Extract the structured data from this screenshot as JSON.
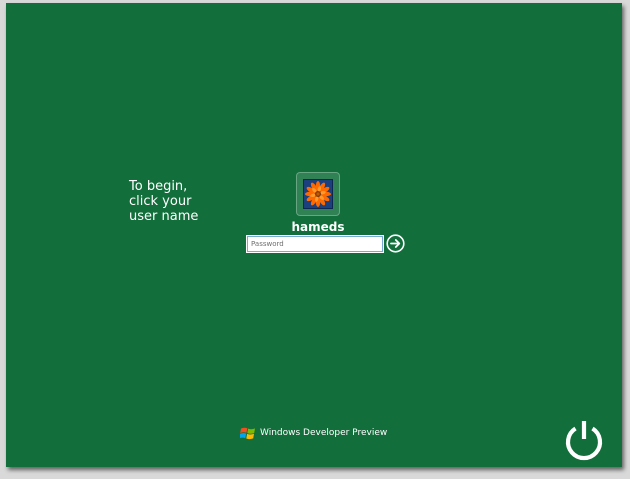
{
  "instructions": {
    "line1": "To begin,",
    "line2": "click your",
    "line3": "user name"
  },
  "user": {
    "name": "hameds",
    "avatar_icon": "flower-icon"
  },
  "password": {
    "placeholder": "Password",
    "value": ""
  },
  "submit": {
    "icon": "arrow-right-circle-icon"
  },
  "branding": {
    "logo_icon": "windows-flag-icon",
    "text": "Windows Developer Preview"
  },
  "power": {
    "icon": "power-icon"
  },
  "colors": {
    "background": "#126f3b",
    "text": "#ffffff",
    "flower_petal": "#ff6a00",
    "avatar_bg": "#1c3f7d"
  }
}
